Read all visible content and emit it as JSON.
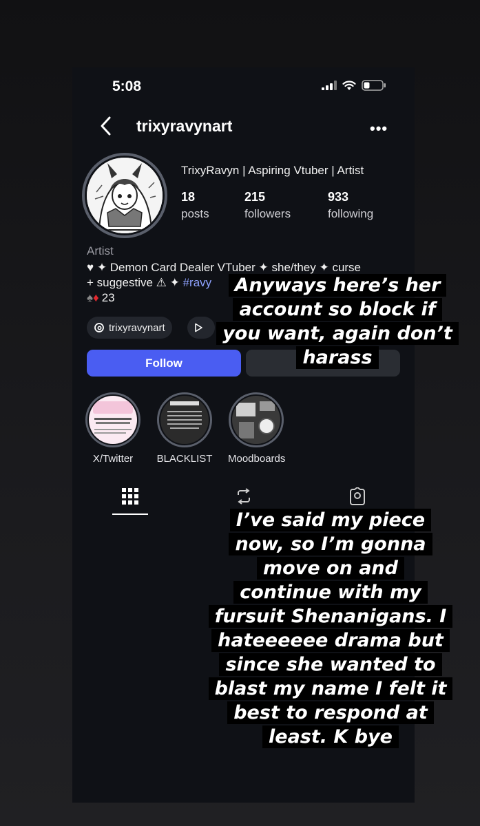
{
  "status_bar": {
    "time": "5:08"
  },
  "profile": {
    "username": "trixyravynart",
    "display_name": "TrixyRavyn | Aspiring Vtuber | Artist",
    "stats": [
      {
        "value": "18",
        "label": "posts"
      },
      {
        "value": "215",
        "label": "followers"
      },
      {
        "value": "933",
        "label": "following"
      }
    ],
    "category": "Artist",
    "bio_line1": "♥ ✦ Demon Card Dealer VTuber ✦ she/they ✦ curse",
    "bio_line2": "+ suggestive ⚠ ✦ ",
    "bio_hashtag": "#ravy",
    "bio_line3_suits": "♠♦",
    "bio_line3_number": "23",
    "threads_handle": "trixyravynart",
    "follow_label": "Follow"
  },
  "highlights": [
    {
      "label": "X/Twitter"
    },
    {
      "label": "BLACKLIST"
    },
    {
      "label": "Moodboards"
    }
  ],
  "overlay_captions": {
    "top": [
      "Anyways here’s her",
      "account so block if",
      "you want, again don’t",
      "harass"
    ],
    "bottom": [
      "I’ve said my piece",
      "now, so I’m gonna",
      "move on and",
      "continue with my",
      "fursuit Shenanigans. I",
      "hateeeeee drama but",
      "since she wanted to",
      "blast my name I felt it",
      "best to respond at",
      "least. K bye"
    ]
  },
  "colors": {
    "follow_button": "#4a5df2",
    "hashtag": "#8ea2ff",
    "card_suit_red": "#e0282e",
    "caption_bg": "#000000"
  }
}
